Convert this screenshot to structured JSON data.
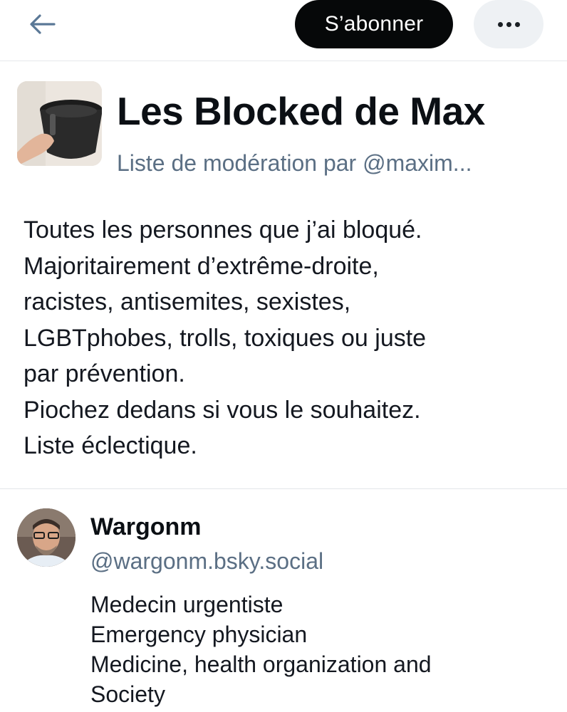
{
  "header": {
    "back_icon": "arrow-left-icon",
    "subscribe_label": "S’abonner",
    "more_icon": "ellipsis-icon"
  },
  "list": {
    "title": "Les Blocked de Max",
    "subtitle": "Liste de modération par @maxim...",
    "description": [
      "Toutes les personnes que j’ai bloqué.",
      "Majoritairement d’extrême-droite,",
      "racistes, antisemites, sexistes,",
      "LGBTphobes, trolls, toxiques ou juste",
      "par prévention.",
      "Piochez dedans si vous le souhaitez.",
      "Liste éclectique."
    ]
  },
  "member": {
    "name": "Wargonm",
    "handle": "@wargonm.bsky.social",
    "bio": [
      "Medecin urgentiste",
      "Emergency physician",
      "Medicine, health organization and",
      "Society"
    ]
  },
  "colors": {
    "accent_dark": "#060809",
    "muted_text": "#5b6f84",
    "pill_bg": "#eef1f4"
  }
}
